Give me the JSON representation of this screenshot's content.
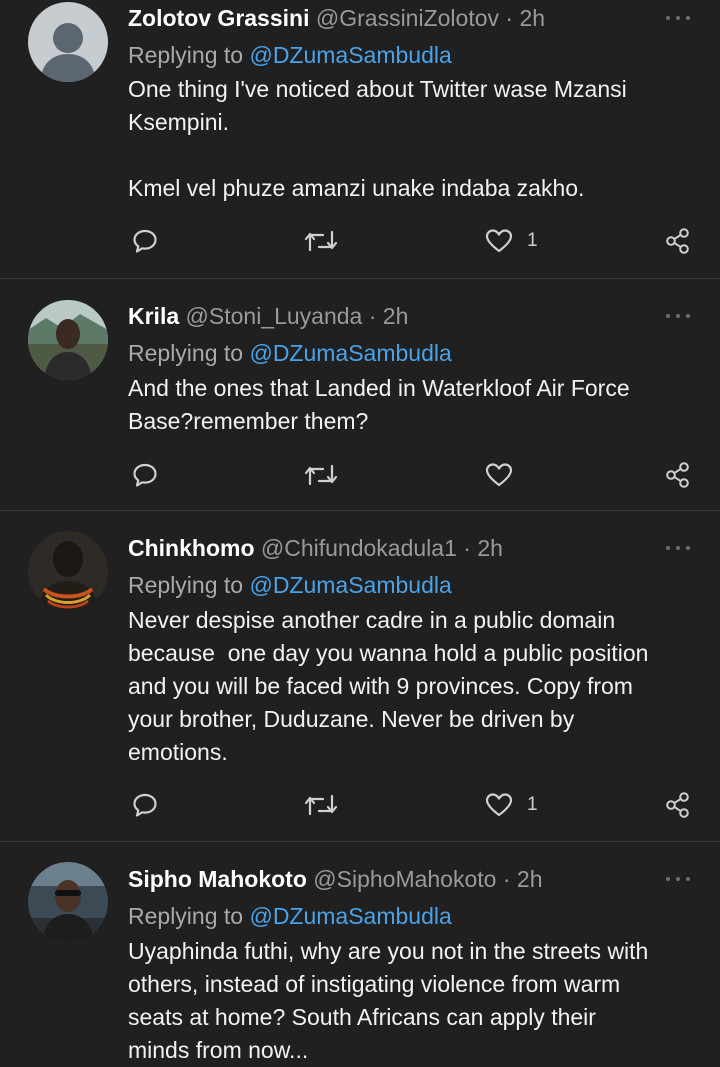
{
  "tweets": [
    {
      "name": "Zolotov Grassini",
      "handle": "@GrassiniZolotov",
      "separator": "·",
      "time": "2h",
      "replying_prefix": "Replying to ",
      "replying_to": "@DZumaSambudla",
      "text": "One thing I've noticed about Twitter wase Mzansi\nKsempini.\n\nKmel vel phuze amanzi unake indaba zakho.",
      "like_count": "1",
      "avatar": "default-avatar"
    },
    {
      "name": "Krila",
      "handle": "@Stoni_Luyanda",
      "separator": "·",
      "time": "2h",
      "replying_prefix": "Replying to ",
      "replying_to": "@DZumaSambudla",
      "text": "And the ones that Landed in Waterkloof Air Force\nBase?remember them?",
      "like_count": "",
      "avatar": "photo-avatar"
    },
    {
      "name": "Chinkhomo",
      "handle": "@Chifundokadula1",
      "separator": "·",
      "time": "2h",
      "replying_prefix": "Replying to ",
      "replying_to": "@DZumaSambudla",
      "text": "Never despise another cadre in a public domain\nbecause  one day you wanna hold a public position\nand you will be faced with 9 provinces. Copy from\nyour brother, Duduzane. Never be driven by\nemotions.",
      "like_count": "1",
      "avatar": "photo-avatar"
    },
    {
      "name": "Sipho Mahokoto",
      "handle": "@SiphoMahokoto",
      "separator": "·",
      "time": "2h",
      "replying_prefix": "Replying to ",
      "replying_to": "@DZumaSambudla",
      "text": "Uyaphinda futhi, why are you not in the streets with\nothers, instead of instigating violence from warm\nseats at home? South Africans can apply their\nminds from now...",
      "like_count": "",
      "avatar": "photo-avatar"
    }
  ],
  "colors": {
    "background": "#202020",
    "mention": "#4aa3e8",
    "muted": "#9a9a9a",
    "divider": "#3a3a3a"
  },
  "icons": [
    "reply-icon",
    "retweet-icon",
    "like-icon",
    "share-icon",
    "more-icon"
  ]
}
